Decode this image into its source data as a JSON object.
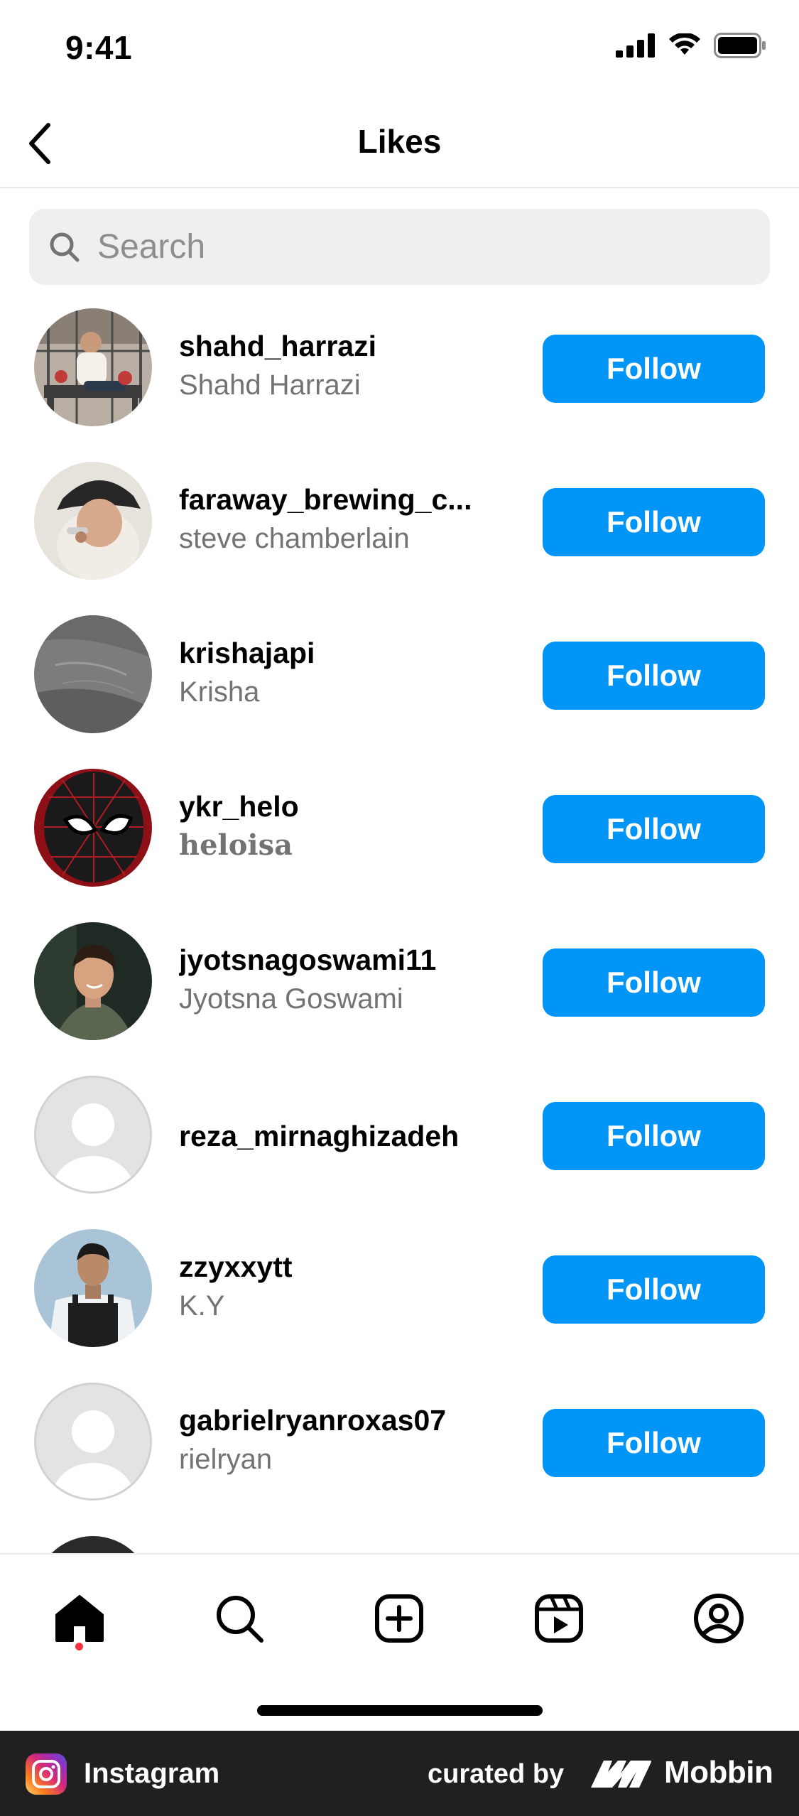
{
  "status_bar": {
    "time": "9:41"
  },
  "header": {
    "title": "Likes"
  },
  "search": {
    "placeholder": "Search"
  },
  "users": [
    {
      "username": "shahd_harrazi",
      "full_name": "Shahd Harrazi",
      "button": "Follow"
    },
    {
      "username": "faraway_brewing_c...",
      "full_name": "steve chamberlain",
      "button": "Follow"
    },
    {
      "username": "krishajapi",
      "full_name": "Krisha",
      "button": "Follow"
    },
    {
      "username": "ykr_helo",
      "full_name": "heloisa",
      "button": "Follow"
    },
    {
      "username": "jyotsnagoswami11",
      "full_name": "Jyotsna Goswami",
      "button": "Follow"
    },
    {
      "username": "reza_mirnaghizadeh",
      "button": "Follow"
    },
    {
      "username": "zzyxxytt",
      "full_name": "K.Y",
      "button": "Follow"
    },
    {
      "username": "gabrielryanroxas07",
      "full_name": "rielryan",
      "button": "Follow"
    }
  ],
  "tab_bar": {
    "tabs": [
      "home-icon",
      "search-icon",
      "create-icon",
      "reels-icon",
      "profile-icon"
    ],
    "active": "home-icon",
    "active_dot_color": "#ff3040"
  },
  "footer": {
    "app_name": "Instagram",
    "curated_by": "curated by",
    "brand": "Mobbin"
  },
  "colors": {
    "follow_button": "#0095f6",
    "secondary_text": "#737373",
    "search_bg": "#efefef"
  }
}
